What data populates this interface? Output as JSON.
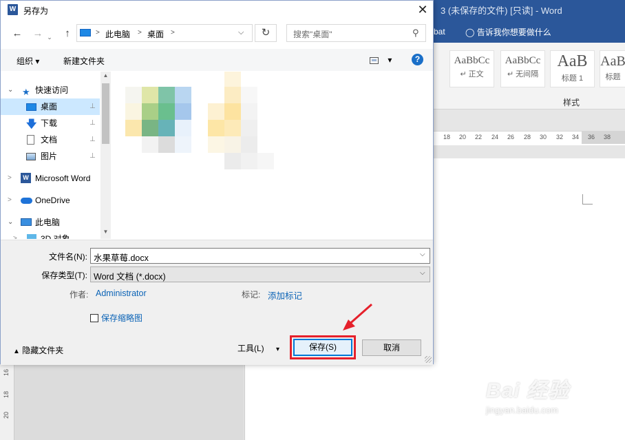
{
  "word_window": {
    "title": "3 (未保存的文件) [只读]  -  Word",
    "tab_acrobat": "bat",
    "tell_me": "告诉我你想要做什么",
    "styles": [
      {
        "sample": "AaBbCc",
        "name": "↵ 正文"
      },
      {
        "sample": "AaBbCc",
        "name": "↵ 无间隔"
      },
      {
        "sample": "AaB",
        "name": "标题 1"
      },
      {
        "sample": "AaB",
        "name": "标题"
      }
    ],
    "styles_group_label": "样式",
    "ruler_numbers": [
      "18",
      "20",
      "22",
      "24",
      "26",
      "28",
      "30",
      "32",
      "34",
      "36",
      "38"
    ],
    "vertical_ruler_numbers": [
      "16",
      "18",
      "20"
    ]
  },
  "dialog": {
    "title": "另存为",
    "close_glyph": "✕",
    "nav": {
      "back": "←",
      "forward": "→",
      "up": "↑"
    },
    "address": {
      "crumbs": [
        "此电脑",
        "桌面"
      ],
      "sep": ">",
      "dropdown": "⌵"
    },
    "refresh_glyph": "↻",
    "search_placeholder": "搜索\"桌面\"",
    "toolbar": {
      "organize": "组织 ▾",
      "new_folder": "新建文件夹",
      "view_arrow": "▾",
      "help": "?"
    },
    "nav_pane": {
      "items": [
        {
          "label": "快速访问",
          "icon": "star-icon",
          "chev": "⌄",
          "pin": ""
        },
        {
          "label": "桌面",
          "icon": "desktop-icon",
          "chev": "",
          "pin": "📌"
        },
        {
          "label": "下载",
          "icon": "download-icon",
          "chev": "",
          "pin": "📌"
        },
        {
          "label": "文档",
          "icon": "document-icon",
          "chev": "",
          "pin": "📌"
        },
        {
          "label": "图片",
          "icon": "picture-icon",
          "chev": "",
          "pin": "📌"
        },
        {
          "label": "Microsoft Word",
          "icon": "word-icon",
          "chev": ">",
          "pin": ""
        },
        {
          "label": "OneDrive",
          "icon": "cloud-icon",
          "chev": ">",
          "pin": ""
        },
        {
          "label": "此电脑",
          "icon": "computer-icon",
          "chev": "⌄",
          "pin": ""
        },
        {
          "label": "3D 对象",
          "icon": "3d-objects-icon",
          "chev": ">",
          "pin": ""
        }
      ]
    },
    "form": {
      "filename_label": "文件名(N):",
      "filename_value": "水果草莓.docx",
      "filetype_label": "保存类型(T):",
      "filetype_value": "Word 文档 (*.docx)",
      "author_label": "作者:",
      "author_value": "Administrator",
      "tags_label": "标记:",
      "tags_value": "添加标记",
      "thumbnail_label": "保存缩略图",
      "hide_folders": "隐藏文件夹",
      "tools": "工具(L)",
      "tools_arrow": "▾",
      "save": "保存(S)",
      "cancel": "取消"
    }
  },
  "watermark": {
    "brand": "Bai 经验",
    "url": "jingyan.baidu.com"
  },
  "colors": {
    "word_blue": "#2b579a",
    "accent_blue": "#0078d7",
    "highlight_red": "#e5202b",
    "selection": "#cce8ff"
  }
}
